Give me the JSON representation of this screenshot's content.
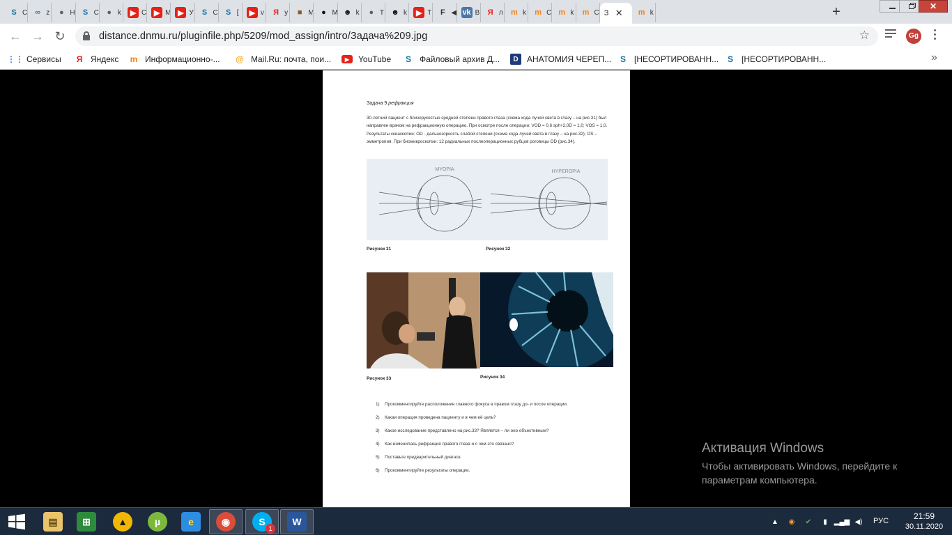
{
  "browser": {
    "tabs": [
      {
        "fav": "S",
        "favColor": "#1a73a8",
        "favBg": "transparent",
        "title": "С",
        "icon": "skype-s-icon"
      },
      {
        "fav": "∞",
        "favColor": "#00979c",
        "favBg": "transparent",
        "title": "z",
        "icon": "arduino-icon"
      },
      {
        "fav": "●",
        "favColor": "#5f6368",
        "favBg": "transparent",
        "title": "Н",
        "icon": "globe-icon"
      },
      {
        "fav": "S",
        "favColor": "#1a73a8",
        "favBg": "transparent",
        "title": "С",
        "icon": "skype-s-icon"
      },
      {
        "fav": "●",
        "favColor": "#5f6368",
        "favBg": "transparent",
        "title": "k",
        "icon": "globe-icon"
      },
      {
        "fav": "▶",
        "favColor": "#ffffff",
        "favBg": "#e62117",
        "title": "С",
        "icon": "youtube-icon"
      },
      {
        "fav": "▶",
        "favColor": "#ffffff",
        "favBg": "#e62117",
        "title": "М",
        "icon": "youtube-icon"
      },
      {
        "fav": "▶",
        "favColor": "#ffffff",
        "favBg": "#e62117",
        "title": "У",
        "icon": "youtube-icon"
      },
      {
        "fav": "S",
        "favColor": "#1a73a8",
        "favBg": "transparent",
        "title": "С",
        "icon": "skype-s-icon"
      },
      {
        "fav": "S",
        "favColor": "#1a73a8",
        "favBg": "transparent",
        "title": "[",
        "icon": "skype-s-icon"
      },
      {
        "fav": "▶",
        "favColor": "#ffffff",
        "favBg": "#e62117",
        "title": "v",
        "icon": "youtube-icon"
      },
      {
        "fav": "Я",
        "favColor": "#e52620",
        "favBg": "transparent",
        "title": "у",
        "icon": "yandex-icon"
      },
      {
        "fav": "■",
        "favColor": "#8b5a2b",
        "favBg": "transparent",
        "title": "М",
        "icon": "image-icon"
      },
      {
        "fav": "●",
        "favColor": "#111111",
        "favBg": "transparent",
        "title": "М",
        "icon": "mask-icon"
      },
      {
        "fav": "☻",
        "favColor": "#111111",
        "favBg": "transparent",
        "title": "k",
        "icon": "avatar-face-icon"
      },
      {
        "fav": "●",
        "favColor": "#5f6368",
        "favBg": "transparent",
        "title": "Т",
        "icon": "globe-icon"
      },
      {
        "fav": "☻",
        "favColor": "#111111",
        "favBg": "transparent",
        "title": "k",
        "icon": "avatar-face-icon"
      },
      {
        "fav": "▶",
        "favColor": "#ffffff",
        "favBg": "#e62117",
        "title": "Т",
        "icon": "youtube-icon"
      },
      {
        "fav": "F",
        "favColor": "#333333",
        "favBg": "transparent",
        "title": "◀",
        "icon": "audio-playing-icon"
      },
      {
        "fav": "vk",
        "favColor": "#ffffff",
        "favBg": "#4a76a8",
        "title": "В",
        "icon": "vk-icon"
      },
      {
        "fav": "Я",
        "favColor": "#e52620",
        "favBg": "transparent",
        "title": "л",
        "icon": "yandex-icon"
      },
      {
        "fav": "m",
        "favColor": "#f98012",
        "favBg": "transparent",
        "title": "k",
        "icon": "moodle-icon"
      },
      {
        "fav": "m",
        "favColor": "#f98012",
        "favBg": "transparent",
        "title": "С",
        "icon": "moodle-icon"
      },
      {
        "fav": "m",
        "favColor": "#f98012",
        "favBg": "transparent",
        "title": "k",
        "icon": "moodle-icon"
      },
      {
        "fav": "m",
        "favColor": "#f98012",
        "favBg": "transparent",
        "title": "С",
        "icon": "moodle-icon"
      }
    ],
    "activeTab": {
      "title": "З"
    },
    "afterTab": {
      "fav": "m",
      "favColor": "#f98012",
      "title": "k"
    },
    "newTabLabel": "+",
    "url": "distance.dnmu.ru/pluginfile.php/5209/mod_assign/intro/Задача%209.jpg",
    "profileInitials": "Gg",
    "bookmarks": [
      {
        "label": "Сервисы",
        "ico": "⋮⋮",
        "icoColor": "#4285f4",
        "icon": "apps-grid-icon"
      },
      {
        "label": "Яндекс",
        "ico": "Я",
        "icoColor": "#e52620",
        "icon": "yandex-icon"
      },
      {
        "label": "Информационно-...",
        "ico": "m",
        "icoColor": "#f98012",
        "icon": "moodle-icon"
      },
      {
        "label": "Mail.Ru: почта, пои...",
        "ico": "@",
        "icoColor": "#f5a623",
        "icon": "mailru-icon"
      },
      {
        "label": "YouTube",
        "ico": "▶",
        "icoColor": "#e62117",
        "icon": "youtube-icon"
      },
      {
        "label": "Файловый архив Д...",
        "ico": "S",
        "icoColor": "#1a73a8",
        "icon": "skype-s-icon"
      },
      {
        "label": "АНАТОМИЯ ЧЕРЕП...",
        "ico": "D",
        "icoColor": "#1d3b7a",
        "icon": "d-logo-icon"
      },
      {
        "label": "[НЕСОРТИРОВАНН...",
        "ico": "S",
        "icoColor": "#1a73a8",
        "icon": "skype-s-icon"
      },
      {
        "label": "[НЕСОРТИРОВАНН...",
        "ico": "S",
        "icoColor": "#1a73a8",
        "icon": "skype-s-icon"
      }
    ],
    "moreBookmarks": "»"
  },
  "document": {
    "titlePrefix": "Задача 9",
    "titleItalic": "рефракция",
    "paragraph": "30-летний пациент с близорукостью средней степени правого глаза (схема хода лучей света в глазу – на рис.31) был направлен врачом на рефракционную операцию. При осмотре после операции: VOD = 0,6 sph+2,0D = 1,0; VOS = 1,0. Результаты скиаскопии: OD - дальнозоркость слабой степени (схема хода лучей света в глазу – на рис.32); OS – эмметропия. При биомикроскопии: 12 радиальных послеоперационных рубцов роговицы OD (рис.34).",
    "figLabelMyopia": "MYOPIA",
    "figLabelHyperopia": "HYPEROPIA",
    "captions": {
      "fig31": "Рисунок 31",
      "fig32": "Рисунок 32",
      "fig33": "Рисунок 33",
      "fig34": "Рисунок 34"
    },
    "questions": [
      {
        "num": "1)",
        "text": "Прокомментируйте расположение главного фокуса в правом глазу до- и после операции."
      },
      {
        "num": "2)",
        "text": "Какая операция проведена пациенту и в чем её цель?"
      },
      {
        "num": "3)",
        "text": "Какое исследование представлено на рис.33? Является – ли оно объективным?"
      },
      {
        "num": "4)",
        "text": "Как изменилась рефракция правого глаза и с чем это связано?"
      },
      {
        "num": "5)",
        "text": "Поставьте предварительный диагноз."
      },
      {
        "num": "6)",
        "text": "Прокомментируйте результаты операции."
      }
    ]
  },
  "watermark": {
    "title": "Активация Windows",
    "subtitle": "Чтобы активировать Windows, перейдите к параметрам компьютера."
  },
  "taskbar": {
    "apps": [
      {
        "name": "explorer",
        "ico": "▤",
        "bg": "#e9c46a",
        "color": "#6b4f12",
        "open": false,
        "icon": "file-explorer-icon"
      },
      {
        "name": "store",
        "ico": "⊞",
        "bg": "#2e8b3e",
        "color": "#ffffff",
        "open": false,
        "icon": "store-icon"
      },
      {
        "name": "archicad",
        "ico": "▲",
        "bg": "#f2b705",
        "color": "#1b1b1b",
        "open": false,
        "icon": "triangle-app-icon"
      },
      {
        "name": "utorrent",
        "ico": "µ",
        "bg": "#7cb93b",
        "color": "#ffffff",
        "open": false,
        "icon": "utorrent-icon"
      },
      {
        "name": "ie",
        "ico": "e",
        "bg": "#2d8de0",
        "color": "#fbd84a",
        "open": false,
        "icon": "internet-explorer-icon"
      },
      {
        "name": "chrome",
        "ico": "◉",
        "bg": "#dd4b39",
        "color": "#ffffff",
        "open": true,
        "icon": "chrome-icon"
      },
      {
        "name": "skype",
        "ico": "S",
        "bg": "#00aff0",
        "color": "#ffffff",
        "open": true,
        "icon": "skype-icon",
        "badge": "1"
      },
      {
        "name": "word",
        "ico": "W",
        "bg": "#2b579a",
        "color": "#ffffff",
        "open": true,
        "icon": "word-icon"
      }
    ],
    "language": "РУС",
    "time": "21:59",
    "date": "30.11.2020"
  }
}
